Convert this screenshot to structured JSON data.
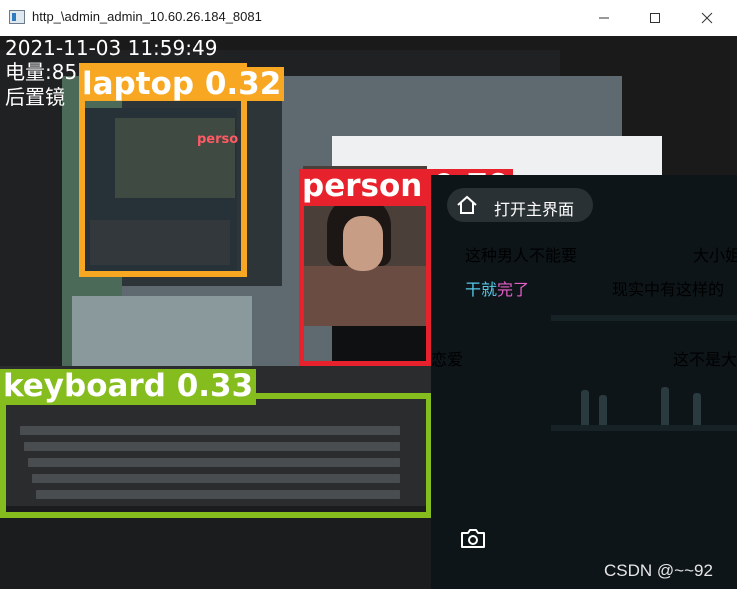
{
  "window": {
    "title": "http_\\admin_admin_10.60.26.184_8081",
    "controls": [
      "minimize-icon",
      "maximize-icon",
      "close-icon"
    ]
  },
  "overlay": {
    "datetime": "2021-11-03 11:59:49",
    "battery": "电量:85",
    "camera": "后置镜"
  },
  "detections": [
    {
      "label": "laptop 0.32",
      "color": "#f7a722"
    },
    {
      "label": "person 0.79",
      "color": "#e8222c"
    },
    {
      "label": "keyboard 0.33",
      "color": "#86bd1e"
    }
  ],
  "inner_labels": {
    "perso": "perso"
  },
  "panel": {
    "home_label": "打开主界面",
    "danmu": [
      {
        "text": "这种男人不能要",
        "color": "#ffffff"
      },
      {
        "text": "大小姐",
        "color": "#ffffff"
      },
      {
        "text": "干就",
        "color": "#56c8e8"
      },
      {
        "text": "完了",
        "color": "#e85ec8"
      },
      {
        "text": "现实中有这样的",
        "color": "#ffffff"
      },
      {
        "text": "恋爱",
        "color": "#ffffff"
      },
      {
        "text": "这不是大",
        "color": "#ffffff"
      }
    ],
    "camera_icon": "camera-icon",
    "watermark": "CSDN @~~92"
  }
}
